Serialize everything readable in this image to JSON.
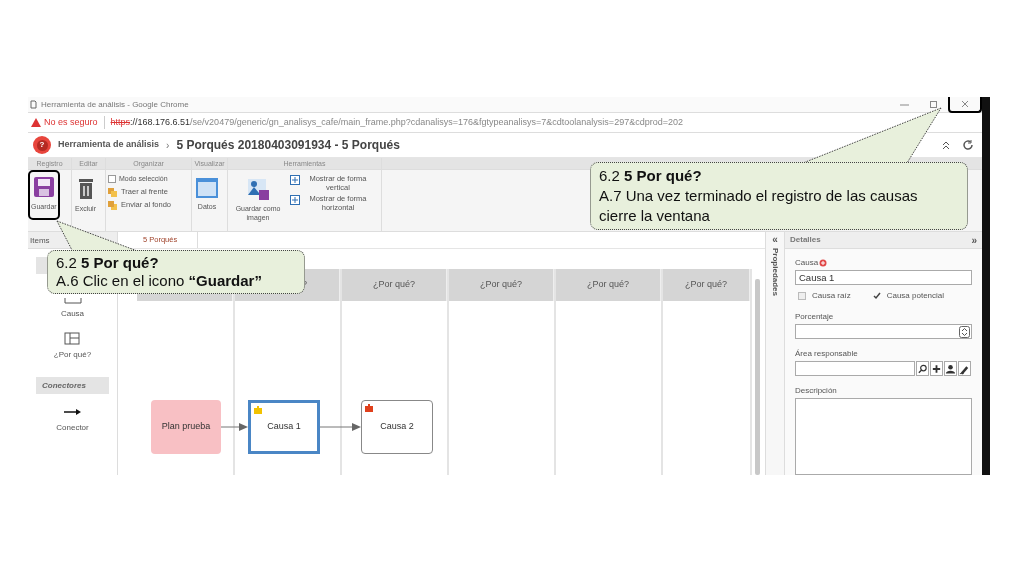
{
  "browser": {
    "title": "Herramienta de análisis - Google Chrome",
    "close_highlighted": true,
    "security": "No es seguro",
    "url": {
      "scheme": "https",
      "host": "://168.176.6.51",
      "path": "/se/v20479/generic/gn_analisys_cafe/main_frame.php?cdanalisys=176&fgtypeanalisys=7&cdtoolanalysis=297&cdprod=202"
    }
  },
  "app_header": {
    "logo_mark": "?",
    "breadcrumb": "Herramienta de análisis",
    "separator": "›",
    "title": "5 Porqués 20180403091934 - 5 Porqués"
  },
  "ribbon": [
    {
      "label": "Registro",
      "items": [
        {
          "kind": "large",
          "label": "Guardar",
          "highlighted": true
        }
      ]
    },
    {
      "label": "Editar",
      "items": [
        {
          "kind": "large",
          "label": "Excluir",
          "highlighted": false
        }
      ]
    },
    {
      "label": "Organizar",
      "items": [
        {
          "kind": "check",
          "label": "Modo selección",
          "checked": false
        },
        {
          "kind": "small",
          "label": "Traer al frente"
        },
        {
          "kind": "small",
          "label": "Enviar al fondo"
        }
      ]
    },
    {
      "label": "Visualizar",
      "items": [
        {
          "kind": "large",
          "label": "Datos",
          "highlighted": false
        }
      ]
    },
    {
      "label": "Herramientas",
      "items": [
        {
          "kind": "large",
          "label": "Guardar como imagen",
          "highlighted": false
        },
        {
          "kind": "small",
          "label": "Mostrar de forma vertical"
        },
        {
          "kind": "small",
          "label": "Mostrar de forma horizontal"
        }
      ]
    }
  ],
  "items_panel": {
    "title": "Items",
    "entries": [
      {
        "kind": "section"
      },
      {
        "kind": "item",
        "label": "Causa"
      },
      {
        "kind": "item",
        "label": "¿Por qué?"
      },
      {
        "kind": "section",
        "label": "Conectores"
      },
      {
        "kind": "item",
        "label": "Conector"
      }
    ]
  },
  "canvas": {
    "tab": "5 Porqués",
    "columns": [
      {},
      {
        "header": "?"
      },
      {
        "header": "¿Por qué?"
      },
      {
        "header": "¿Por qué?"
      },
      {
        "header": "¿Por qué?"
      },
      {
        "header": "¿Por qué?"
      }
    ],
    "nodes": [
      {
        "kind": "problem",
        "label": "Plan prueba",
        "selected": false
      },
      {
        "kind": "cause",
        "label": "Causa 1",
        "selected": true,
        "color": "#f2c200"
      },
      {
        "kind": "cause",
        "label": "Causa 2",
        "selected": false,
        "color": "#e0401c"
      }
    ]
  },
  "side_tab": {
    "collapse": "«",
    "label": "Propiedades"
  },
  "details": {
    "title": "Detalles",
    "expand": "»",
    "cause_label": "Causa",
    "cause_value": "Causa 1",
    "checkboxes": [
      {
        "label": "Causa raíz",
        "checked": false
      },
      {
        "label": "Causa potencial",
        "checked": true
      }
    ],
    "percent_label": "Porcentaje",
    "area_label": "Área responsable",
    "description_label": "Descripción"
  },
  "callouts": [
    {
      "heading": "6.2 **5 Por qué?**",
      "text": "A.6 Clic en el icono **“Guardar”**"
    },
    {
      "heading": "6.2 **5 Por qué?**",
      "text": "A.7 Una vez terminado el registro de las causas cierre la ventana"
    }
  ]
}
